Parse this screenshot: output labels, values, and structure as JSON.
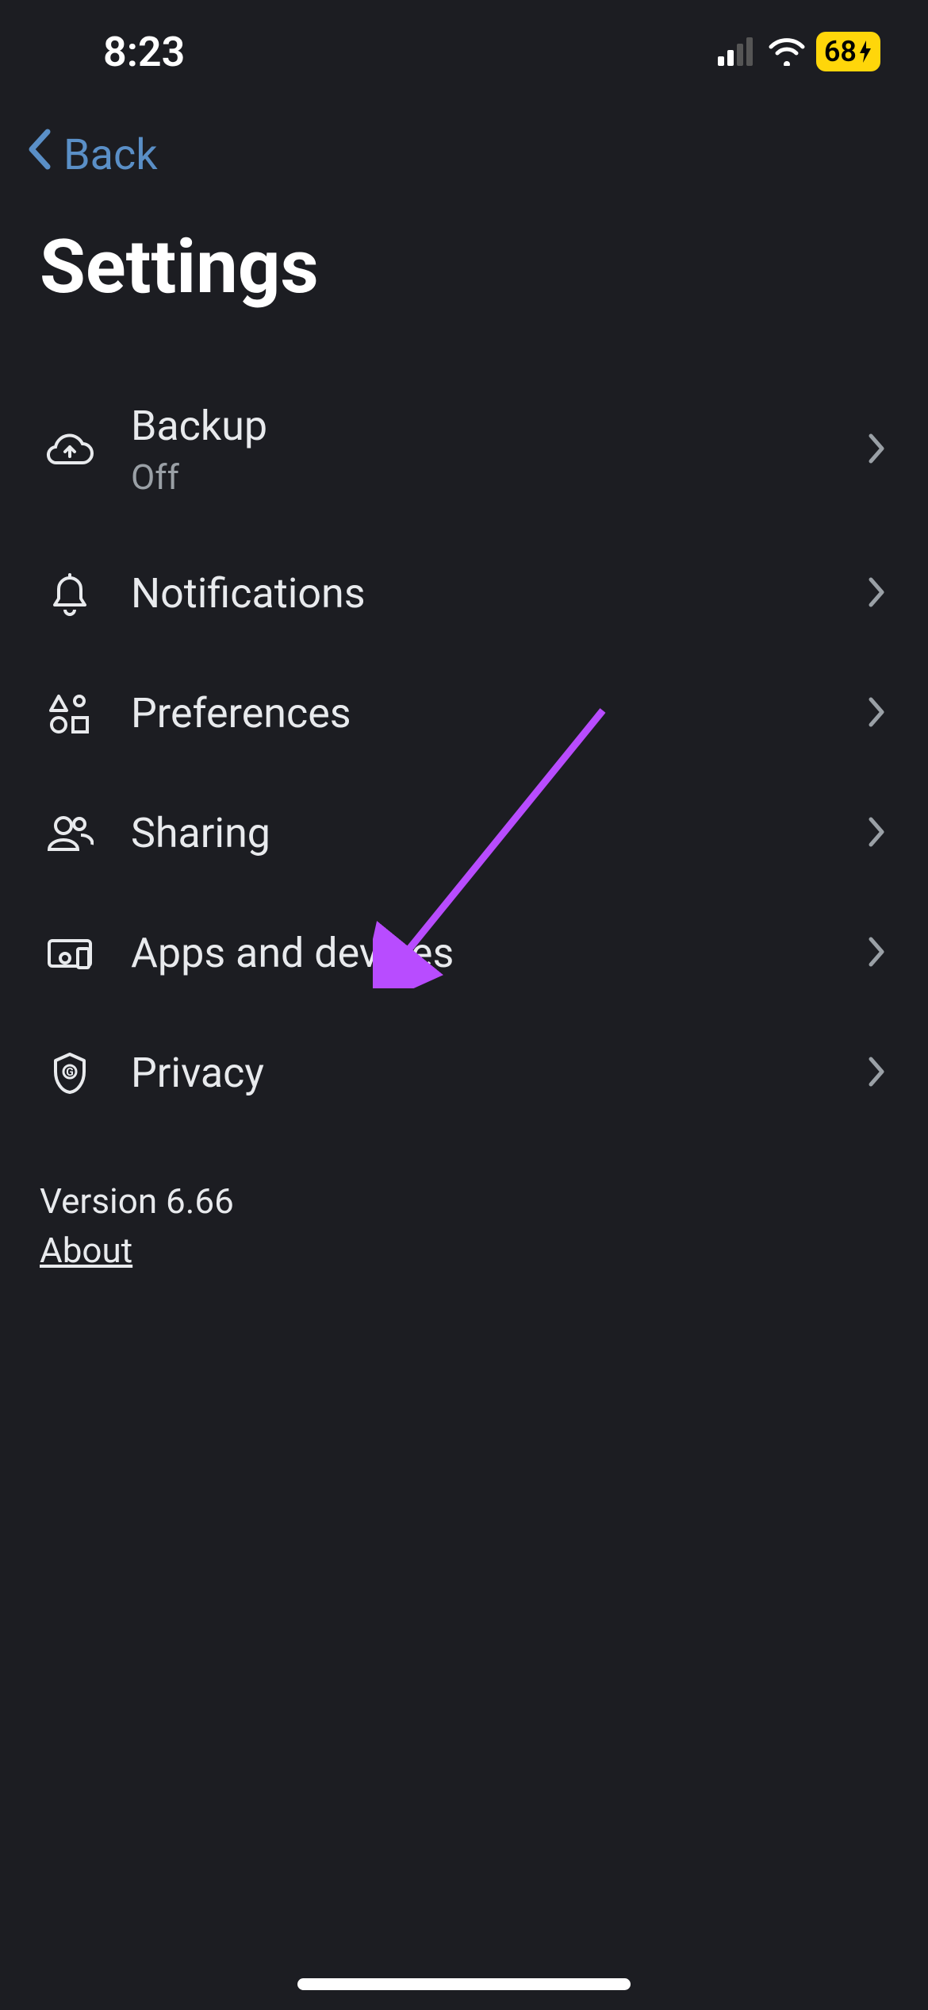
{
  "status_bar": {
    "time": "8:23",
    "battery_percent": "68"
  },
  "nav": {
    "back_label": "Back"
  },
  "page": {
    "title": "Settings"
  },
  "settings": {
    "items": [
      {
        "label": "Backup",
        "sublabel": "Off",
        "icon": "cloud-upload-icon"
      },
      {
        "label": "Notifications",
        "icon": "bell-icon"
      },
      {
        "label": "Preferences",
        "icon": "shapes-icon"
      },
      {
        "label": "Sharing",
        "icon": "people-icon"
      },
      {
        "label": "Apps and devices",
        "icon": "devices-icon"
      },
      {
        "label": "Privacy",
        "icon": "shield-icon"
      }
    ]
  },
  "footer": {
    "version": "Version 6.66",
    "about": "About"
  },
  "annotation": {
    "arrow_color": "#b84cff"
  }
}
